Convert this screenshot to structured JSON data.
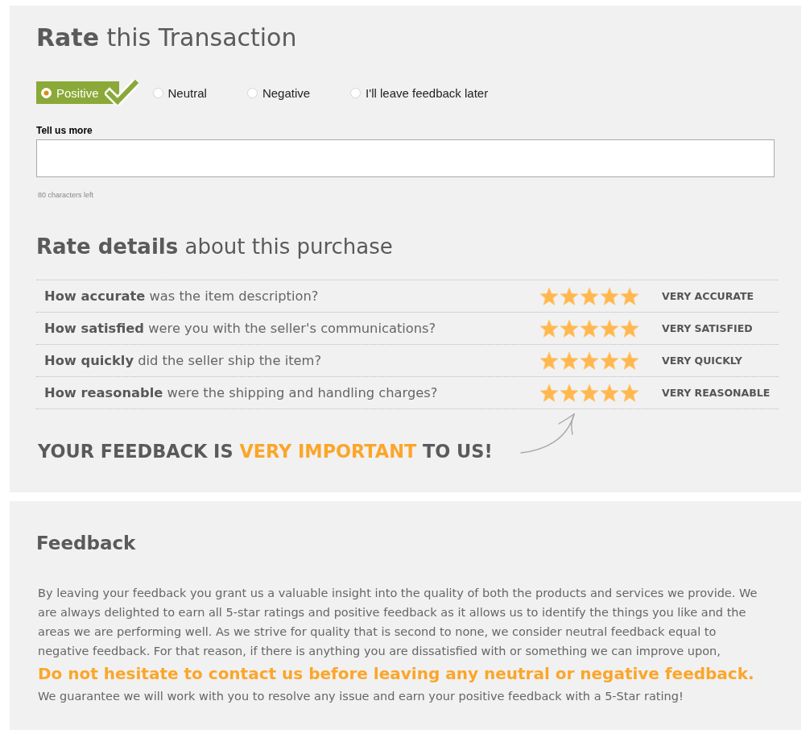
{
  "rating": {
    "title": "**Rate** this Transaction",
    "options": [
      {
        "label": "Positive",
        "selected": true
      },
      {
        "label": "Neutral",
        "selected": false
      },
      {
        "label": "Negative",
        "selected": false
      },
      {
        "label": "I'll leave feedback later",
        "selected": false
      }
    ],
    "comment": {
      "label": "Tell us more",
      "counter": "80 characters left"
    }
  },
  "details": {
    "title": "**Rate details** about this purchase",
    "rows": [
      {
        "question": "**How accurate** was the item description?",
        "stars": 5,
        "rating_label": "VERY ACCURATE"
      },
      {
        "question": "**How satisfied** were you with the seller's communications?",
        "stars": 5,
        "rating_label": "VERY SATISFIED"
      },
      {
        "question": "**How quickly** did the seller ship the item?",
        "stars": 5,
        "rating_label": "VERY QUICKLY"
      },
      {
        "question": "**How reasonable** were the shipping and handling charges?",
        "stars": 5,
        "rating_label": "VERY REASONABLE"
      }
    ],
    "callout": [
      {
        "text": "YOUR FEEDBACK IS",
        "highlight": false
      },
      {
        "text": "VERY IMPORTANT",
        "highlight": true
      },
      {
        "text": "TO US!",
        "highlight": false
      }
    ]
  },
  "feedback": {
    "title": "Feedback",
    "paragraph": "By leaving your feedback you grant us a valuable insight into the quality of both the products and services we provide. We are always delighted to earn all 5-star ratings and positive feedback as it allows us to identify the things you like and the areas we are performing well. As we strive for quality that is second to none, we consider neutral feedback equal to negative feedback. For that reason, if there is anything you are dissatisfied with or something we can improve upon,",
    "highlight": "Do not hesitate to contact us before leaving any neutral or negative feedback.",
    "closing": "We guarantee we will work with you to resolve any issue and earn your positive feedback with a 5-Star rating!"
  }
}
